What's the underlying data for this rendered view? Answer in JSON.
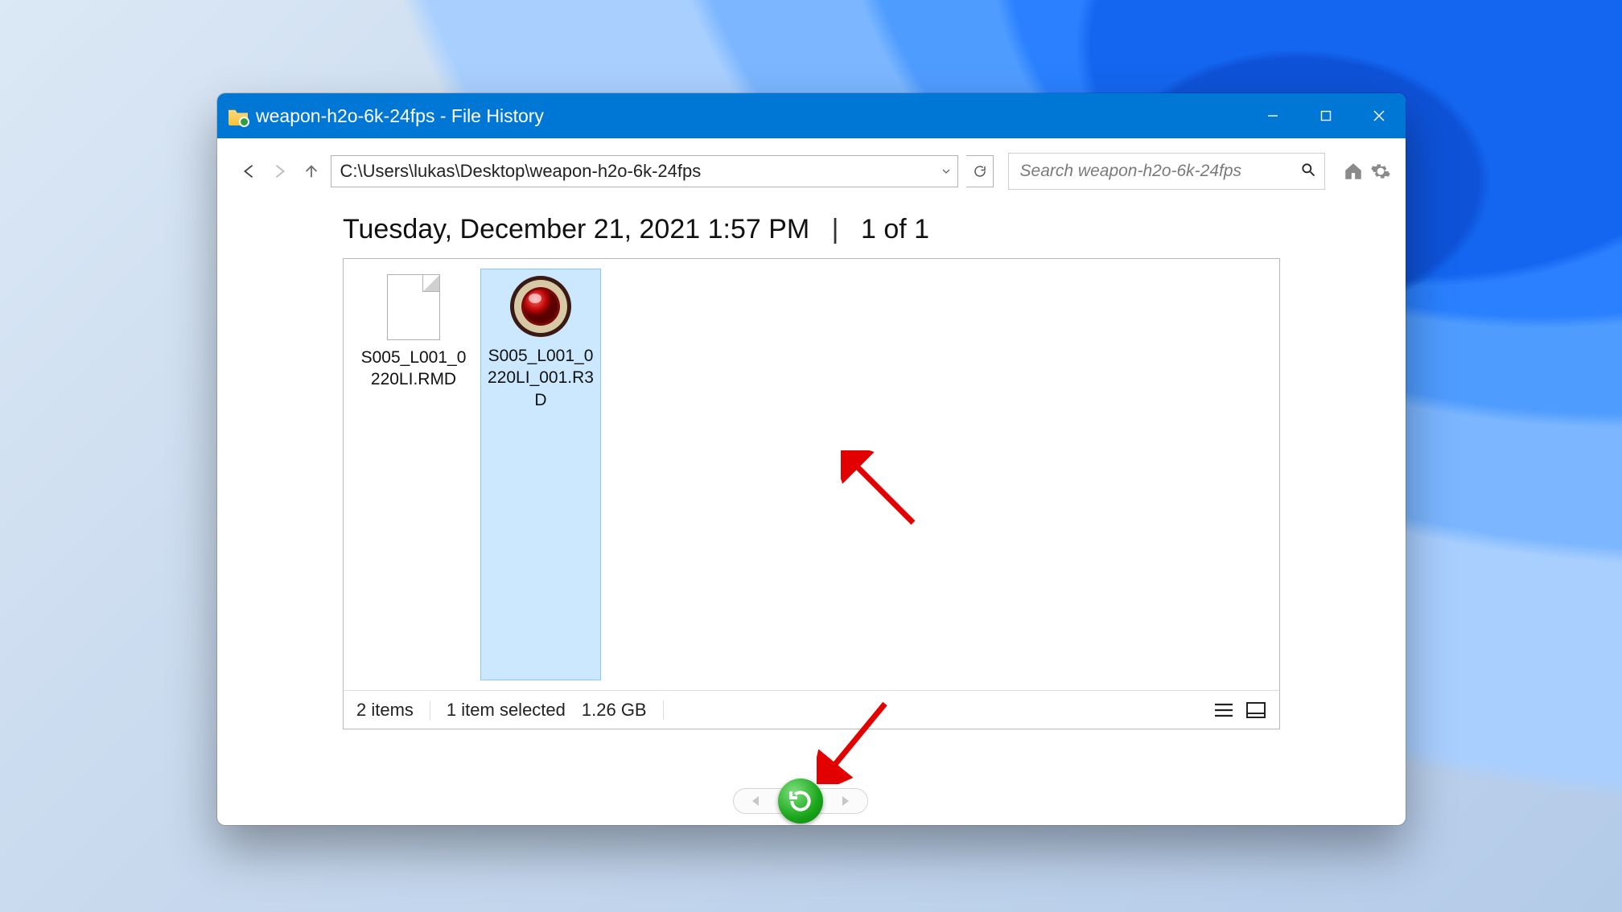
{
  "window": {
    "title": "weapon-h2o-6k-24fps - File History"
  },
  "nav": {
    "path": "C:\\Users\\lukas\\Desktop\\weapon-h2o-6k-24fps",
    "search_placeholder": "Search weapon-h2o-6k-24fps"
  },
  "header": {
    "timestamp": "Tuesday, December 21, 2021 1:57 PM",
    "page": "1 of 1"
  },
  "files": [
    {
      "name": "S005_L001_0220LI.RMD",
      "icon": "generic",
      "selected": false
    },
    {
      "name": "S005_L001_0220LI_001.R3D",
      "icon": "red",
      "selected": true
    }
  ],
  "status": {
    "item_count": "2 items",
    "selection": "1 item selected",
    "size": "1.26 GB"
  }
}
